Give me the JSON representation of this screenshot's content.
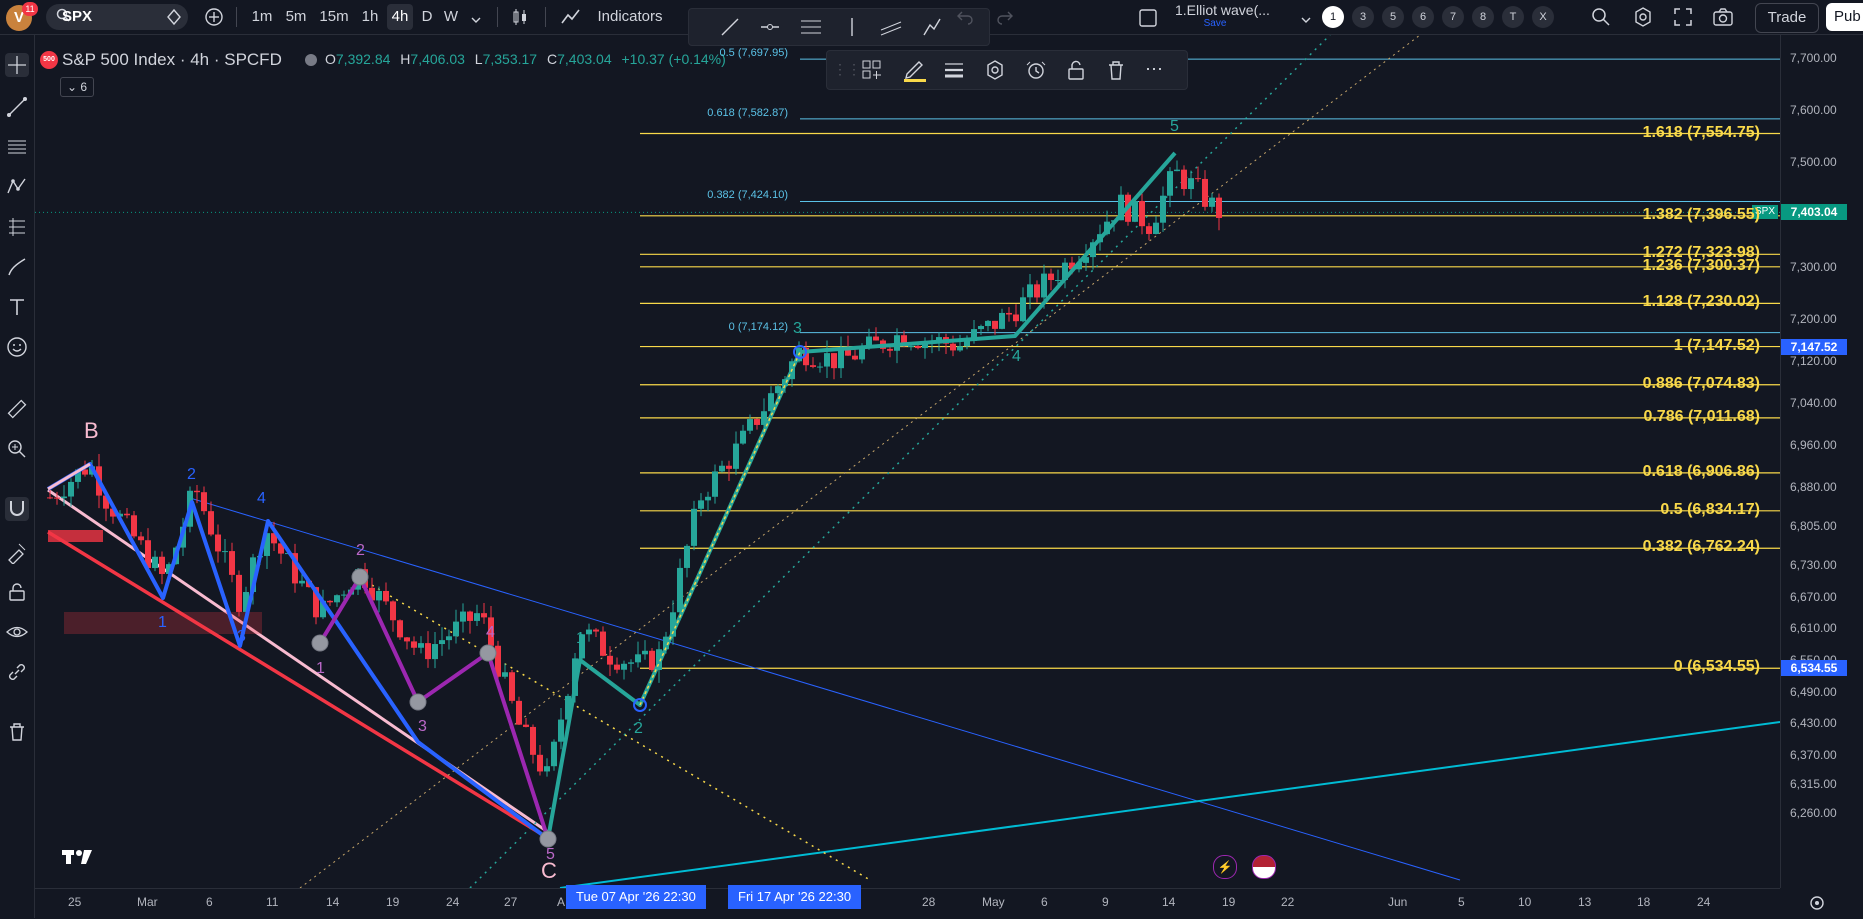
{
  "toolbar": {
    "logo_letter": "V",
    "logo_badge": "11",
    "symbol": "SPX",
    "intervals": [
      "1m",
      "5m",
      "15m",
      "1h",
      "4h",
      "D",
      "W"
    ],
    "active_interval": "4h",
    "indicators_label": "Indicators",
    "layout_name": "1.Elliot wave(...",
    "layout_sub": "Save",
    "layout_pills": [
      "1",
      "3",
      "5",
      "6",
      "7",
      "8",
      "T",
      "X"
    ],
    "trade_label": "Trade",
    "publish_label": "Pub"
  },
  "legend": {
    "badge": "500",
    "title": "S&P 500 Index · 4h · SPCFD",
    "o_label": "O",
    "o": "7,392.84",
    "h_label": "H",
    "h": "7,406.03",
    "l_label": "L",
    "l": "7,353.17",
    "c_label": "C",
    "c": "7,403.04",
    "change": "+10.37 (+0.14%)",
    "indicators_count": "6"
  },
  "fib_right": [
    {
      "label": "1.618 (7,554.75)",
      "value": 7554.75
    },
    {
      "label": "1.382 (7,396.55)",
      "value": 7396.55
    },
    {
      "label": "1.272 (7,323.98)",
      "value": 7323.98
    },
    {
      "label": "1.236 (7,300.37)",
      "value": 7300.37
    },
    {
      "label": "1.128 (7,230.02)",
      "value": 7230.02
    },
    {
      "label": "1 (7,147.52)",
      "value": 7147.52
    },
    {
      "label": "0.886 (7,074.83)",
      "value": 7074.83
    },
    {
      "label": "0.786 (7,011.68)",
      "value": 7011.68
    },
    {
      "label": "0.618 (6,906.86)",
      "value": 6906.86
    },
    {
      "label": "0.5 (6,834.17)",
      "value": 6834.17
    },
    {
      "label": "0.382 (6,762.24)",
      "value": 6762.24
    },
    {
      "label": "0 (6,534.55)",
      "value": 6534.55
    }
  ],
  "fib_retrace": [
    {
      "label": "0.5 (7,697.95)",
      "value": 7697.95
    },
    {
      "label": "0.618 (7,582.87)",
      "value": 7582.87
    },
    {
      "label": "0.382 (7,424.10)",
      "value": 7424.1
    },
    {
      "label": "0 (7,174.12)",
      "value": 7174.12
    }
  ],
  "price_axis": [
    "7,700.00",
    "7,600.00",
    "7,500.00",
    "7,400.00",
    "7,300.00",
    "7,200.00",
    "7,120.00",
    "7,040.00",
    "6,960.00",
    "6,880.00",
    "6,805.00",
    "6,730.00",
    "6,670.00",
    "6,610.00",
    "6,550.00",
    "6,490.00",
    "6,430.00",
    "6,370.00",
    "6,315.00",
    "6,260.00"
  ],
  "price_badges": [
    {
      "text": "7,403.04",
      "color": "#089981"
    },
    {
      "text": "7,147.52",
      "color": "#2962ff"
    },
    {
      "text": "6,534.55",
      "color": "#2962ff"
    }
  ],
  "spx_tag": "SPX",
  "time_axis": [
    "25",
    "Mar",
    "6",
    "11",
    "14",
    "19",
    "24",
    "27",
    "A",
    "28",
    "May",
    "6",
    "9",
    "14",
    "19",
    "22",
    "Jun",
    "5",
    "10",
    "13",
    "18",
    "24"
  ],
  "time_badges": [
    "Tue 07 Apr '26   22:30",
    "Fri 17 Apr '26   22:30"
  ],
  "wave_labels": {
    "B": "B",
    "C": "C",
    "blue": [
      "1",
      "2",
      "3",
      "4"
    ],
    "purple": [
      "1",
      "2",
      "3",
      "4",
      "5"
    ],
    "green": [
      "1",
      "2",
      "3",
      "4",
      "5"
    ]
  },
  "colors": {
    "bg": "#131722",
    "up": "#26a69a",
    "down": "#f23645",
    "fib": "#f9d94a",
    "retrace": "#5bc2e7",
    "green_wave": "#26a69a",
    "blue_wave": "#2962ff",
    "purple_wave": "#9c27b0",
    "pink_wave": "#f8bbd0",
    "red_line": "#f23645",
    "cyan_line": "#00bcd4"
  }
}
